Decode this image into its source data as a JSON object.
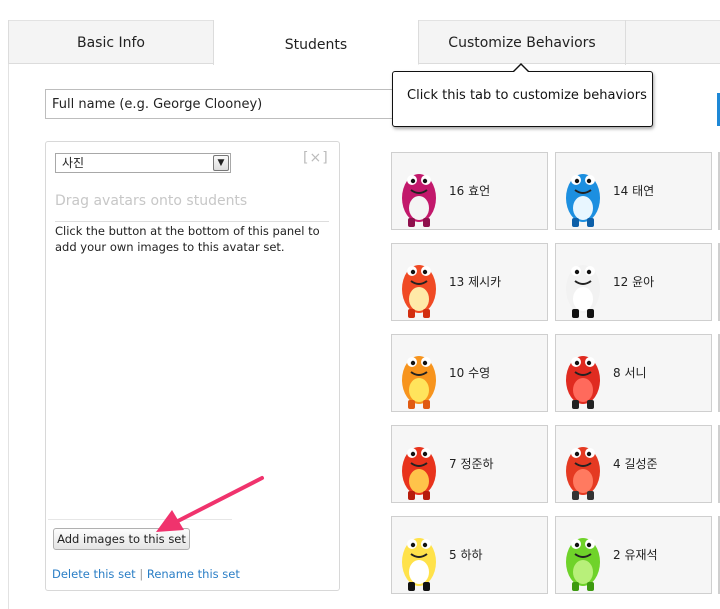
{
  "tabs": {
    "basic_info": "Basic Info",
    "students": "Students",
    "customize_behaviors": "Customize Behaviors"
  },
  "name_input": {
    "placeholder": "Full name (e.g. George Clooney)"
  },
  "tooltip": {
    "text": "Click this tab to customize behaviors"
  },
  "avatar_panel": {
    "set_select_value": "사진",
    "close_label": "[×]",
    "drag_hint": "Drag avatars onto students",
    "help_text": "Click the button at the bottom of this panel to add your own images to this avatar set.",
    "add_button": "Add images to this set",
    "delete_link": "Delete this set",
    "separator": "|",
    "rename_link": "Rename this set"
  },
  "students": [
    {
      "label": "16 효언",
      "monster": "magenta"
    },
    {
      "label": "14 태연",
      "monster": "blue"
    },
    {
      "label": "13 제시카",
      "monster": "orange-red"
    },
    {
      "label": "12 윤아",
      "monster": "black-white"
    },
    {
      "label": "10 수영",
      "monster": "orange"
    },
    {
      "label": "8 서니",
      "monster": "red-spiky"
    },
    {
      "label": "7 정준하",
      "monster": "red-furry"
    },
    {
      "label": "4 길성준",
      "monster": "red-horned"
    },
    {
      "label": "5 하하",
      "monster": "yellow-black"
    },
    {
      "label": "2 유재석",
      "monster": "green-cyclops"
    }
  ],
  "colors": {
    "link": "#2a7ec6",
    "arrow": "#f0336d",
    "accent_blue": "#1e88d6"
  }
}
